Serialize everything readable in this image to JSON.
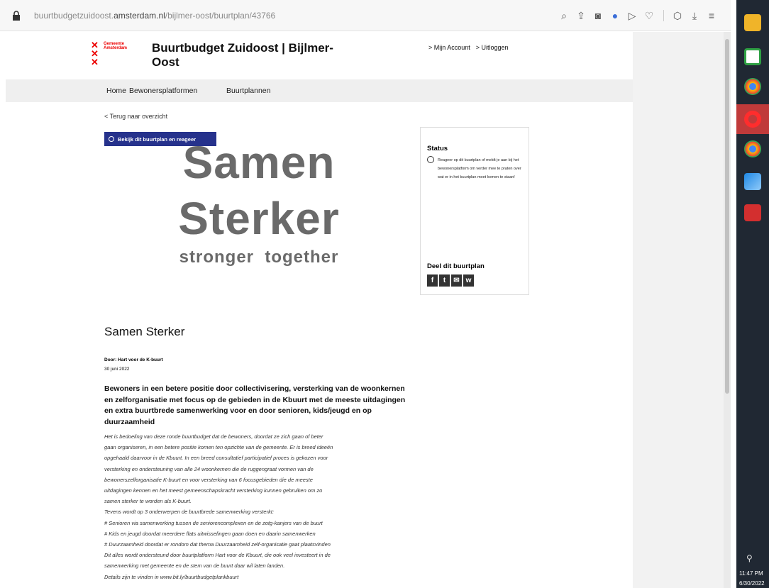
{
  "browser": {
    "url_prefix": "buurtbudgetzuidoost.",
    "url_host": "amsterdam.nl",
    "url_path": "/bijlmer-oost/buurtplan/43766"
  },
  "site": {
    "logo_text": "Gemeente Amsterdam",
    "title": "Buurtbudget Zuidoost | Bijlmer-Oost",
    "account_link": "> Mijn Account",
    "logout_link": "> Uitloggen"
  },
  "nav": {
    "items": [
      "Home",
      "Bewonersplatformen",
      "Buurtplannen"
    ]
  },
  "page": {
    "back_link": "< Terug naar overzicht",
    "view_button": "Bekijk dit buurtplan en reageer",
    "hero": {
      "line1": "Samen",
      "line2": "Sterker",
      "line3": "stronger  together"
    }
  },
  "sidebar": {
    "status_title": "Status",
    "status_text": "Reageer op dit buurtplan of meldt je aan bij het bewonersplatform om verder mee te praten over wat er in het buurtplan moet komen te staan!",
    "share_title": "Deel dit buurtplan",
    "share_icons": [
      "f",
      "t",
      "✉",
      "w"
    ]
  },
  "article": {
    "title": "Samen Sterker",
    "author": "Door: Hart voor de K-buurt",
    "date": "30 juni 2022",
    "lead": "Bewoners in een betere positie door collectivisering, versterking van de woonkernen en zelforganisatie met focus op de gebieden in de Kbuurt met de meeste uitdagingen en extra buurtbrede samenwerking voor en door senioren, kids/jeugd en op duurzaamheid",
    "body": [
      "Het is bedoeling van deze ronde buurtbudget dat de bewoners, doordat ze zich gaan of beter",
      "gaan organiseren, in een betere positie komen ten opzichte van de gemeente. Er is breed ideeën",
      "opgehaald daarvoor in de Kbuurt. In een breed consultatief participatief proces is gekozen voor",
      "versterking en ondersteuning van alle 24 woonkernen die de ruggengraat vormen van de",
      "bewonerszelforganisatie K-buurt en voor versterking van 6 focusgebieden die de meeste",
      "uitdagingen kennen en het meest gemeenschapskracht versterking kunnen gebruiken om zo",
      "samen sterker te worden als K-buurt.",
      "Tevens wordt op 3 onderwerpen de buurtbrede samenwerking versterkt:",
      "# Senioren via samenwerking tussen de seniorencomplexen en de zotg-kanjers van de buurt",
      "# Kids en jeugd doordat meerdere flats uitwisselingen gaan doen en daarin samenwerken",
      "# Duurzaamheid doordat er rondom dat thema Duurzaamheid zelf-organisatie gaat plaatsvinden",
      "Dit alles wordt ondersteund door buurtplatform Hart voor de Kbuurt, die ook veel investeert in de",
      "samenwerking met gemeente en de stem van de buurt daar wil laten landen.",
      "Details zijn te vinden in www.bit.ly/buurtbudgetplankbuurt"
    ]
  },
  "taskbar": {
    "time": "11:47 PM",
    "date": "6/30/2022"
  },
  "colors": {
    "brand_red": "#ec0000",
    "button_blue": "#26328c",
    "hero_gray": "#6a6a6a"
  }
}
